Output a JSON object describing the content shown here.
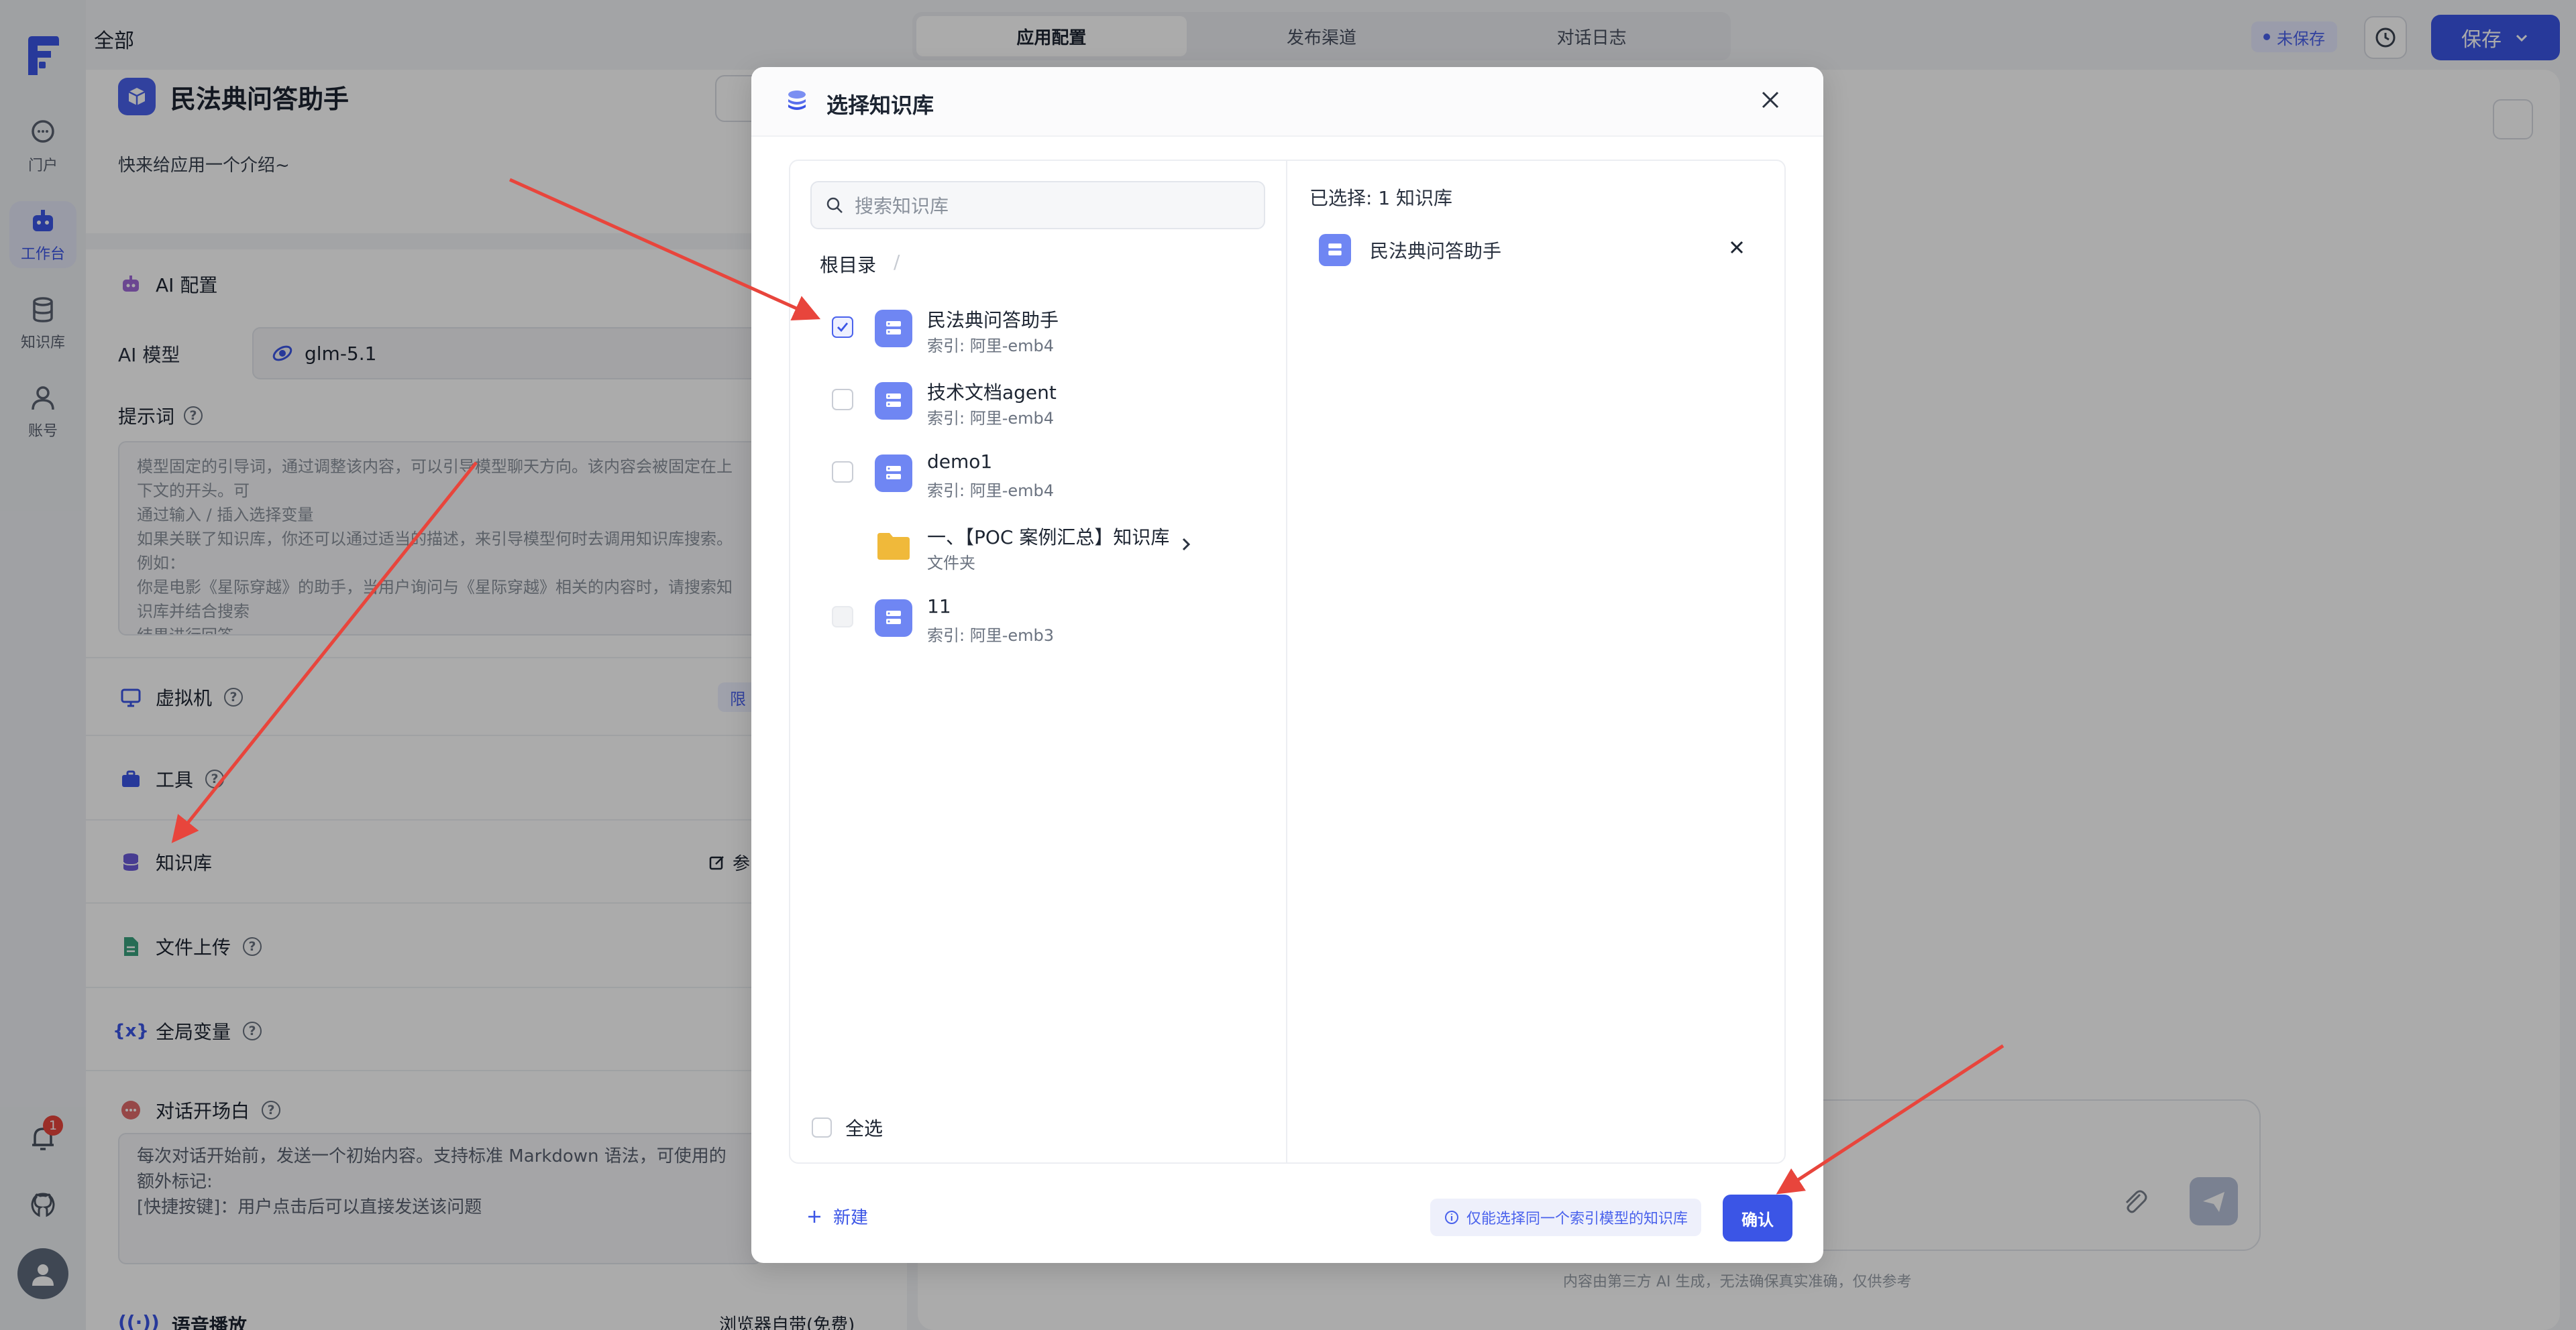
{
  "nav": {
    "items": [
      {
        "label": "门户",
        "icon": "chat-bubble-icon"
      },
      {
        "label": "工作台",
        "icon": "robot-icon"
      },
      {
        "label": "知识库",
        "icon": "database-icon"
      },
      {
        "label": "账号",
        "icon": "user-icon"
      }
    ],
    "notification_count": "1"
  },
  "topbar": {
    "breadcrumb": "全部",
    "tabs": [
      "应用配置",
      "发布渠道",
      "对话日志"
    ],
    "unsaved_label": "未保存",
    "save_label": "保存"
  },
  "app": {
    "name": "民法典问答助手",
    "intro": "快来给应用一个介绍~"
  },
  "ai_config": {
    "title": "AI 配置",
    "model_label": "AI 模型",
    "model_value": "glm-5.1",
    "prompt_label": "提示词",
    "prompt_placeholder": "模型固定的引导词，通过调整该内容，可以引导模型聊天方向。该内容会被固定在上下文的开头。可\n通过输入 / 插入选择变量\n如果关联了知识库，你还可以通过适当的描述，来引导模型何时去调用知识库搜索。例如：\n你是电影《星际穿越》的助手，当用户询问与《星际穿越》相关的内容时，请搜索知识库并结合搜索\n结果进行回答。"
  },
  "sections": {
    "vm": "虚拟机",
    "vm_right": "限",
    "tools": "工具",
    "kb": "知识库",
    "kb_right": "参",
    "file_upload": "文件上传",
    "global_vars": "全局变量",
    "opening": "对话开场白",
    "opening_text": "每次对话开始前，发送一个初始内容。支持标准 Markdown 语法，可使用的额外标记:\n[快捷按键]：用户点击后可以直接发送该问题",
    "voice": "语音播放",
    "voice_right": "浏览器自带(免费)"
  },
  "chat": {
    "footnote": "内容由第三方 AI 生成，无法确保真实准确，仅供参考"
  },
  "modal": {
    "title": "选择知识库",
    "search_placeholder": "搜索知识库",
    "root": "根目录",
    "root_sep": "/",
    "items": [
      {
        "name": "民法典问答助手",
        "sub": "索引: 阿里-emb4",
        "state": "checked"
      },
      {
        "name": "技术文档agent",
        "sub": "索引: 阿里-emb4",
        "state": "unchecked"
      },
      {
        "name": "demo1",
        "sub": "索引: 阿里-emb4",
        "state": "unchecked"
      },
      {
        "name": "一、【POC 案例汇总】知识库",
        "sub": "文件夹",
        "state": "folder"
      },
      {
        "name": "11",
        "sub": "索引: 阿里-emb3",
        "state": "disabled"
      }
    ],
    "select_all": "全选",
    "selected_count": "已选择: 1 知识库",
    "selected": [
      {
        "name": "民法典问答助手"
      }
    ],
    "new_label": "新建",
    "hint": "仅能选择同一个索引模型的知识库",
    "confirm": "确认"
  },
  "colors": {
    "accent": "#3b55e6",
    "kb_icon": "#6f86f3",
    "folder": "#f0b93a",
    "annotation_arrow": "#e8453c"
  }
}
